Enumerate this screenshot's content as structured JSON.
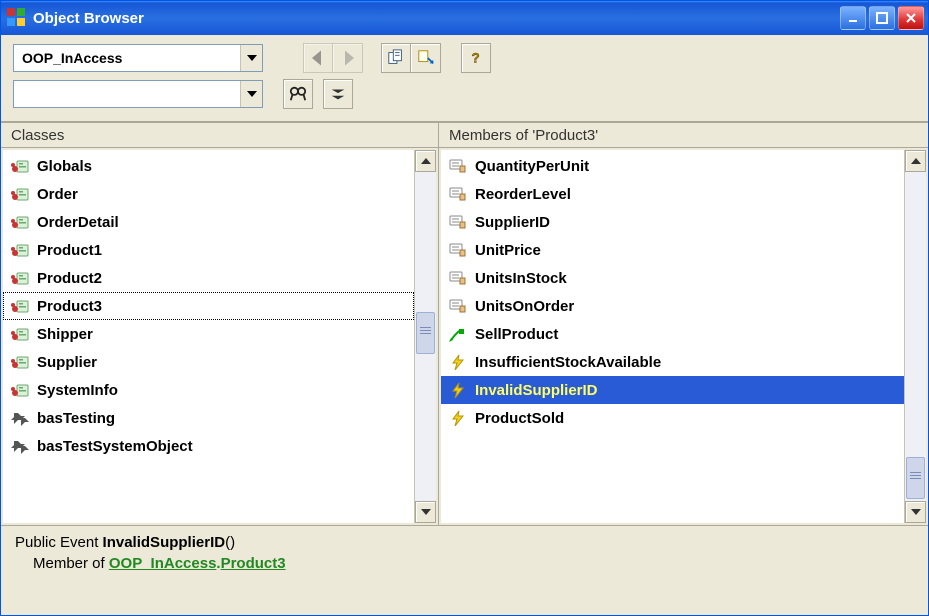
{
  "window": {
    "title": "Object Browser"
  },
  "toolbar": {
    "library_combo": "OOP_InAccess",
    "search_combo": ""
  },
  "panes": {
    "classes_header": "Classes",
    "members_header": "Members of 'Product3'"
  },
  "classes": [
    {
      "icon": "class",
      "label": "Globals"
    },
    {
      "icon": "class",
      "label": "Order"
    },
    {
      "icon": "class",
      "label": "OrderDetail"
    },
    {
      "icon": "class",
      "label": "Product1"
    },
    {
      "icon": "class",
      "label": "Product2"
    },
    {
      "icon": "class",
      "label": "Product3",
      "focused": true
    },
    {
      "icon": "class",
      "label": "Shipper"
    },
    {
      "icon": "class",
      "label": "Supplier"
    },
    {
      "icon": "class",
      "label": "SystemInfo"
    },
    {
      "icon": "module",
      "label": "basTesting"
    },
    {
      "icon": "module",
      "label": "basTestSystemObject"
    }
  ],
  "members": [
    {
      "icon": "prop",
      "label": "QuantityPerUnit"
    },
    {
      "icon": "prop",
      "label": "ReorderLevel"
    },
    {
      "icon": "prop",
      "label": "SupplierID"
    },
    {
      "icon": "prop",
      "label": "UnitPrice"
    },
    {
      "icon": "prop",
      "label": "UnitsInStock"
    },
    {
      "icon": "prop",
      "label": "UnitsOnOrder"
    },
    {
      "icon": "method",
      "label": "SellProduct"
    },
    {
      "icon": "event",
      "label": "InsufficientStockAvailable"
    },
    {
      "icon": "event",
      "label": "InvalidSupplierID",
      "selected": true
    },
    {
      "icon": "event",
      "label": "ProductSold"
    }
  ],
  "detail": {
    "prefix": "Public Event ",
    "name": "InvalidSupplierID",
    "suffix": "()",
    "member_of_label": "Member of ",
    "link_lib": "OOP_InAccess",
    "link_cls": "Product3"
  }
}
